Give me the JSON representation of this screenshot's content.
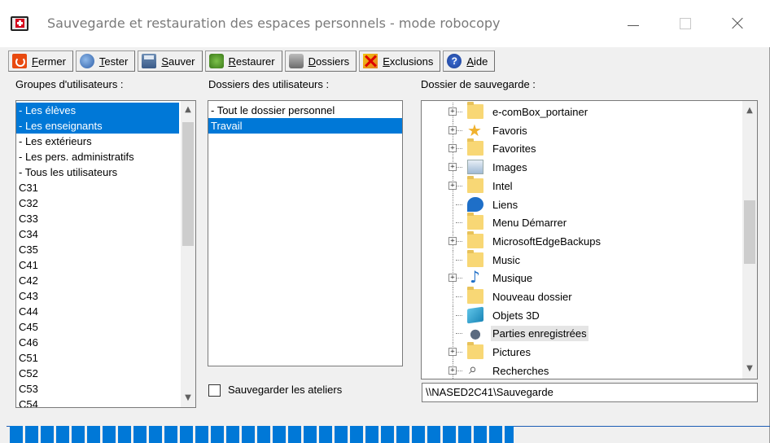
{
  "window": {
    "title": "Sauvegarde et restauration des espaces personnels - mode robocopy"
  },
  "toolbar": {
    "buttons": [
      {
        "prefix": "",
        "underline": "F",
        "rest": "ermer",
        "icon": "power-icon"
      },
      {
        "prefix": "",
        "underline": "T",
        "rest": "ester",
        "icon": "test-icon"
      },
      {
        "prefix": "",
        "underline": "S",
        "rest": "auver",
        "icon": "save-icon"
      },
      {
        "prefix": "",
        "underline": "R",
        "rest": "estaurer",
        "icon": "restore-icon"
      },
      {
        "prefix": "",
        "underline": "D",
        "rest": "ossiers",
        "icon": "folders-icon"
      },
      {
        "prefix": "",
        "underline": "E",
        "rest": "xclusions",
        "icon": "exclusions-icon"
      },
      {
        "prefix": "",
        "underline": "A",
        "rest": "ide",
        "icon": "help-icon"
      }
    ]
  },
  "groups": {
    "label": "Groupes d'utilisateurs :",
    "items": [
      {
        "text": "- Les élèves",
        "selected": true
      },
      {
        "text": "- Les enseignants",
        "selected": true
      },
      {
        "text": "- Les extérieurs",
        "selected": false
      },
      {
        "text": "- Les pers. administratifs",
        "selected": false
      },
      {
        "text": "- Tous les utilisateurs",
        "selected": false
      },
      {
        "text": "C31",
        "selected": false
      },
      {
        "text": "C32",
        "selected": false
      },
      {
        "text": "C33",
        "selected": false
      },
      {
        "text": "C34",
        "selected": false
      },
      {
        "text": "C35",
        "selected": false
      },
      {
        "text": "C41",
        "selected": false
      },
      {
        "text": "C42",
        "selected": false
      },
      {
        "text": "C43",
        "selected": false
      },
      {
        "text": "C44",
        "selected": false
      },
      {
        "text": "C45",
        "selected": false
      },
      {
        "text": "C46",
        "selected": false
      },
      {
        "text": "C51",
        "selected": false
      },
      {
        "text": "C52",
        "selected": false
      },
      {
        "text": "C53",
        "selected": false
      },
      {
        "text": "C54",
        "selected": false
      }
    ]
  },
  "folders": {
    "label": "Dossiers des utilisateurs :",
    "items": [
      {
        "text": "- Tout le dossier personnel",
        "selected": false
      },
      {
        "text": "Travail",
        "selected": true
      }
    ],
    "checkbox_label": "Sauvegarder les ateliers",
    "checkbox_checked": false
  },
  "backup": {
    "label": "Dossier de sauvegarde :",
    "tree": [
      {
        "text": "e-comBox_portainer",
        "icon": "folder-icon",
        "expandable": true,
        "highlight": false
      },
      {
        "text": "Favoris",
        "icon": "star-icon",
        "expandable": true,
        "highlight": false
      },
      {
        "text": "Favorites",
        "icon": "folder-icon",
        "expandable": true,
        "highlight": false
      },
      {
        "text": "Images",
        "icon": "images-icon",
        "expandable": true,
        "highlight": false
      },
      {
        "text": "Intel",
        "icon": "folder-icon",
        "expandable": true,
        "highlight": false
      },
      {
        "text": "Liens",
        "icon": "links-icon",
        "expandable": false,
        "highlight": false
      },
      {
        "text": "Menu Démarrer",
        "icon": "folder-icon",
        "expandable": false,
        "highlight": false
      },
      {
        "text": "MicrosoftEdgeBackups",
        "icon": "folder-icon",
        "expandable": true,
        "highlight": false
      },
      {
        "text": "Music",
        "icon": "folder-icon",
        "expandable": false,
        "highlight": false
      },
      {
        "text": "Musique",
        "icon": "music-icon",
        "expandable": true,
        "highlight": false
      },
      {
        "text": "Nouveau dossier",
        "icon": "folder-icon",
        "expandable": false,
        "highlight": false
      },
      {
        "text": "Objets 3D",
        "icon": "3d-objects-icon",
        "expandable": false,
        "highlight": false
      },
      {
        "text": "Parties enregistrées",
        "icon": "saved-games-icon",
        "expandable": false,
        "highlight": true
      },
      {
        "text": "Pictures",
        "icon": "folder-icon",
        "expandable": true,
        "highlight": false
      },
      {
        "text": "Recherches",
        "icon": "search-icon",
        "expandable": true,
        "highlight": false
      }
    ],
    "path": "\\\\NASED2C41\\Sauvegarde"
  },
  "progress": {
    "fraction": 0.66
  }
}
